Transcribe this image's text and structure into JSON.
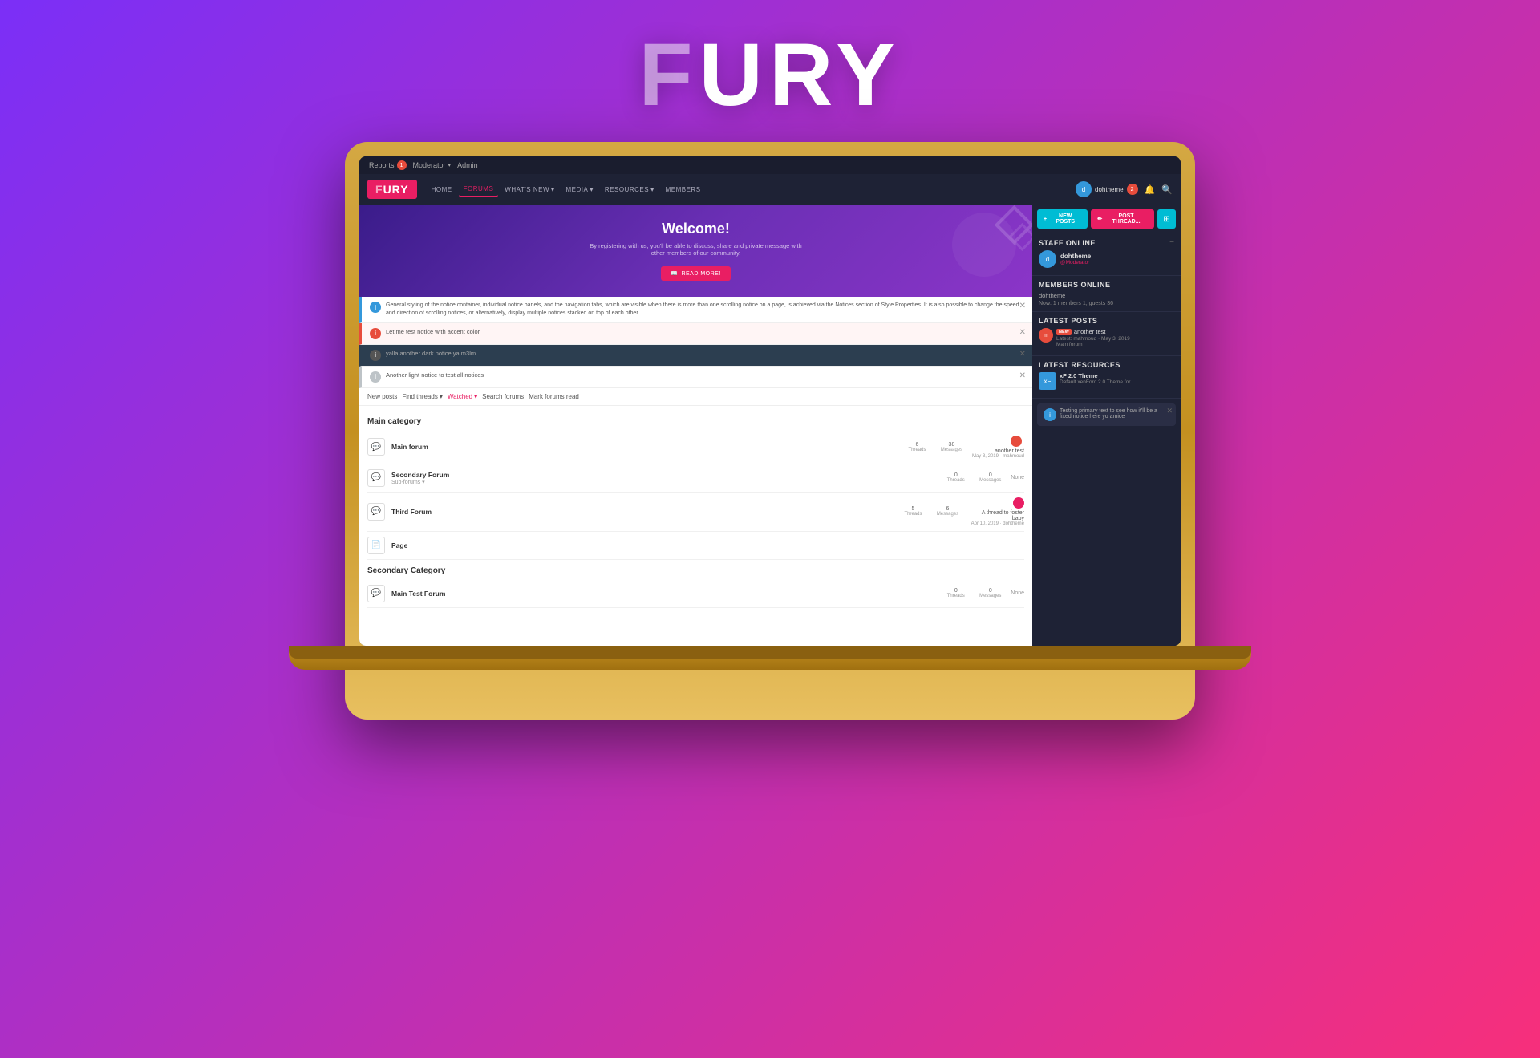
{
  "brand": {
    "title": "FURY",
    "f_letter": "F",
    "rest": "URY"
  },
  "admin_bar": {
    "reports_label": "Reports",
    "reports_count": "1",
    "moderator_label": "Moderator",
    "admin_label": "Admin"
  },
  "nav": {
    "logo_f": "F",
    "logo_rest": "URY",
    "links": [
      {
        "label": "HOME",
        "active": false
      },
      {
        "label": "FORUMS",
        "active": true
      },
      {
        "label": "WHAT'S NEW",
        "active": false,
        "has_arrow": true
      },
      {
        "label": "MEDIA",
        "active": false,
        "has_arrow": true
      },
      {
        "label": "RESOURCES",
        "active": false,
        "has_arrow": true
      },
      {
        "label": "MEMBERS",
        "active": false
      }
    ],
    "user": {
      "name": "dohtheme",
      "notification_count": "2"
    }
  },
  "welcome": {
    "title": "Welcome!",
    "subtitle": "By registering with us, you'll be able to discuss, share and private message with other members of our community.",
    "read_more": "READ MORE!"
  },
  "notices": [
    {
      "type": "blue",
      "text": "General styling of the notice container, individual notice panels, and the navigation tabs, which are visible when there is more than one scrolling notice on a page, is achieved via the Notices section of Style Properties. It is also possible to change the speed and direction of scrolling notices, or alternatively, display multiple notices stacked on top of each other",
      "closeable": true
    },
    {
      "type": "red",
      "text": "Let me test notice with accent color",
      "closeable": true
    },
    {
      "type": "dark",
      "text": "yalla another dark notice ya m3lm",
      "closeable": true
    },
    {
      "type": "light",
      "text": "Another light notice to test all notices",
      "closeable": true
    }
  ],
  "forum_toolbar": {
    "new_posts": "New posts",
    "find_threads": "Find threads",
    "watched": "Watched",
    "search_forums": "Search forums",
    "mark_forums_read": "Mark forums read"
  },
  "main_category": {
    "title": "Main category",
    "forums": [
      {
        "name": "Main forum",
        "threads": "6",
        "messages": "38",
        "last_post": "another test",
        "last_date": "May 3, 2019",
        "last_user": "mahmoud",
        "avatar_color": "#e74c3c"
      },
      {
        "name": "Secondary Forum",
        "sub": "Sub-forums ▾",
        "threads": "0",
        "messages": "0",
        "last_post": "None"
      },
      {
        "name": "Third Forum",
        "threads": "5",
        "messages": "6",
        "last_post": "A thread to foster baby",
        "last_date": "Apr 10, 2019",
        "last_user": "dohtheme",
        "avatar_color": "#e91e63"
      },
      {
        "name": "Page",
        "is_page": true
      }
    ]
  },
  "secondary_category": {
    "title": "Secondary Category",
    "forums": [
      {
        "name": "Main Test Forum",
        "threads": "0",
        "messages": "0",
        "last_post": "None"
      }
    ]
  },
  "sidebar": {
    "new_posts_btn": "NEW POSTS",
    "post_thread_btn": "POST THREAD...",
    "staff_online": {
      "title": "Staff online",
      "users": [
        {
          "name": "dohtheme",
          "role": "@Moderator",
          "avatar_color": "#3498db"
        }
      ]
    },
    "members_online": {
      "title": "Members online",
      "users": [
        "dohtheme"
      ],
      "count": "Now: 1 members 1, guests 36"
    },
    "latest_posts": {
      "title": "Latest posts",
      "items": [
        {
          "badge": "NEW",
          "title": "another test",
          "meta": "Latest: mahmoud · May 3, 2019",
          "forum": "Main forum",
          "avatar_color": "#e74c3c"
        }
      ]
    },
    "latest_resources": {
      "title": "Latest resources",
      "items": [
        {
          "title": "xF 2.0 Theme",
          "desc": "Default xenForo 2.0 Theme for",
          "icon_color": "#3498db"
        }
      ]
    },
    "toast": {
      "text": "Testing primary text to see how it'll be a fixed notice here yo amice",
      "closeable": true
    }
  }
}
